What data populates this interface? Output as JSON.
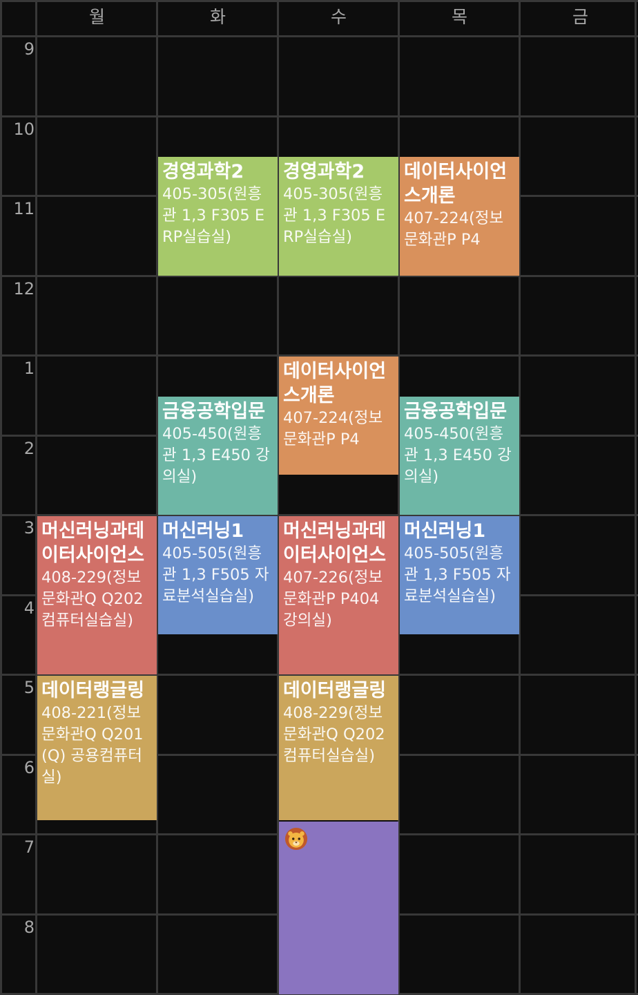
{
  "days": [
    "월",
    "화",
    "수",
    "목",
    "금"
  ],
  "hours": [
    "9",
    "10",
    "11",
    "12",
    "1",
    "2",
    "3",
    "4",
    "5",
    "6",
    "7",
    "8"
  ],
  "colors": {
    "background": "#0d0d0d",
    "grid_line": "#383838",
    "label": "#a8a8a8",
    "green": "#a6c96a",
    "orange": "#d9915c",
    "teal": "#6eb7a6",
    "red": "#d17068",
    "blue": "#6a8fcb",
    "gold": "#cba65c",
    "purple": "#8a74c0"
  },
  "courses": [
    {
      "day": 1,
      "start": 10.5,
      "end": 12,
      "title": "경영과학2",
      "room": "405-305(원흥관 1,3 F305 ERP실습실)",
      "color": "#a6c96a"
    },
    {
      "day": 2,
      "start": 10.5,
      "end": 12,
      "title": "경영과학2",
      "room": "405-305(원흥관 1,3 F305 ERP실습실)",
      "color": "#a6c96a"
    },
    {
      "day": 3,
      "start": 10.5,
      "end": 12,
      "title": "데이터사이언스개론",
      "room": "407-224(정보문화관P P4",
      "color": "#d9915c"
    },
    {
      "day": 2,
      "start": 13,
      "end": 14.5,
      "title": "데이터사이언스개론",
      "room": "407-224(정보문화관P P4",
      "color": "#d9915c"
    },
    {
      "day": 1,
      "start": 13.5,
      "end": 15,
      "title": "금융공학입문",
      "room": "405-450(원흥관 1,3 E450 강의실)",
      "color": "#6eb7a6"
    },
    {
      "day": 3,
      "start": 13.5,
      "end": 15,
      "title": "금융공학입문",
      "room": "405-450(원흥관 1,3 E450 강의실)",
      "color": "#6eb7a6"
    },
    {
      "day": 0,
      "start": 15,
      "end": 17,
      "title": "머신러닝과데이터사이언스",
      "room": "408-229(정보문화관Q Q202 컴퓨터실습실)",
      "color": "#d17068"
    },
    {
      "day": 1,
      "start": 15,
      "end": 16.5,
      "title": "머신러닝1",
      "room": "405-505(원흥관 1,3 F505 자료분석실습실)",
      "color": "#6a8fcb"
    },
    {
      "day": 2,
      "start": 15,
      "end": 17,
      "title": "머신러닝과데이터사이언스",
      "room": "407-226(정보문화관P P404 강의실)",
      "color": "#d17068"
    },
    {
      "day": 3,
      "start": 15,
      "end": 16.5,
      "title": "머신러닝1",
      "room": "405-505(원흥관 1,3 F505 자료분석실습실)",
      "color": "#6a8fcb"
    },
    {
      "day": 0,
      "start": 17,
      "end": 18.83,
      "title": "데이터랭글링",
      "room": "408-221(정보문화관Q Q201 (Q) 공용컴퓨터실)",
      "color": "#cba65c"
    },
    {
      "day": 2,
      "start": 17,
      "end": 18.83,
      "title": "데이터랭글링",
      "room": "408-229(정보문화관Q Q202 컴퓨터실습실)",
      "color": "#cba65c"
    },
    {
      "day": 2,
      "start": 18.83,
      "end": 21.2,
      "title": "",
      "room": "",
      "color": "#8a74c0",
      "icon": "lion-face-icon"
    }
  ]
}
